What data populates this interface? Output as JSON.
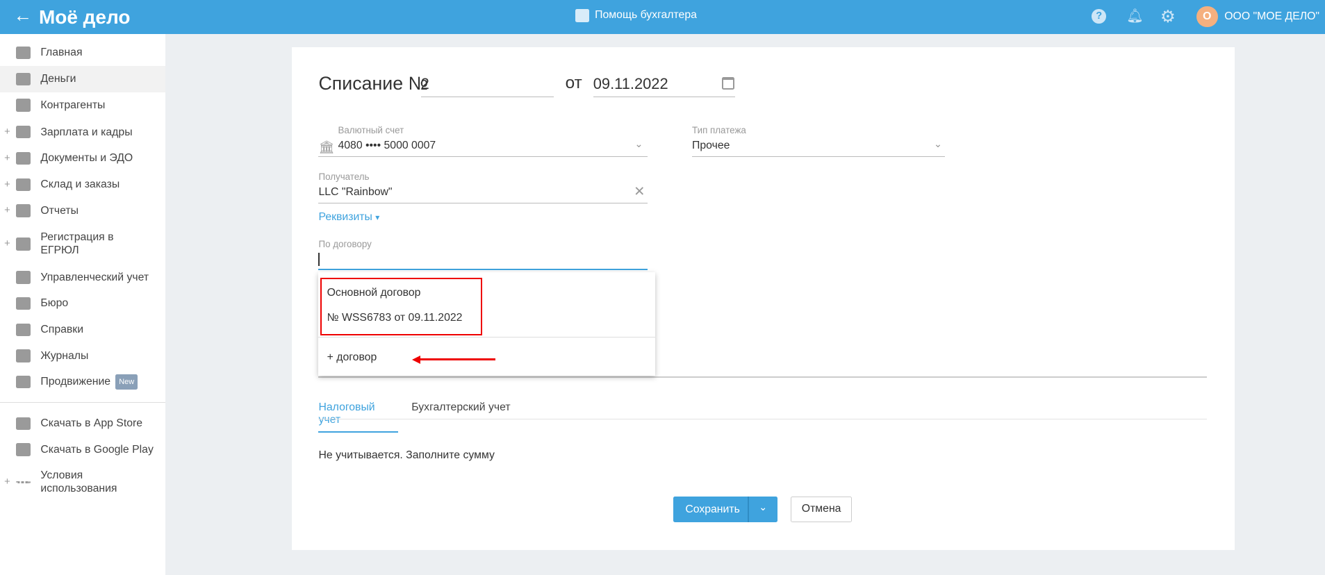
{
  "header": {
    "logo": "Моё дело",
    "help_title": "Помощь бухгалтера",
    "avatar_letter": "О",
    "company": "ООО \"МОЕ ДЕЛО\""
  },
  "sidebar": {
    "items": [
      {
        "label": "Главная",
        "icon": "home-icon",
        "plus": false
      },
      {
        "label": "Деньги",
        "icon": "money-icon",
        "plus": false,
        "active": true
      },
      {
        "label": "Контрагенты",
        "icon": "contractor-icon",
        "plus": false
      },
      {
        "label": "Зарплата и кадры",
        "icon": "wallet-icon",
        "plus": true
      },
      {
        "label": "Документы и ЭДО",
        "icon": "folder-icon",
        "plus": true
      },
      {
        "label": "Склад и заказы",
        "icon": "warehouse-icon",
        "plus": true
      },
      {
        "label": "Отчеты",
        "icon": "report-icon",
        "plus": true
      },
      {
        "label": "Регистрация в ЕГРЮЛ",
        "icon": "registration-icon",
        "plus": true
      },
      {
        "label": "Управленческий учет",
        "icon": "ruble-icon",
        "plus": false
      },
      {
        "label": "Бюро",
        "icon": "briefcase-icon",
        "plus": false
      },
      {
        "label": "Справки",
        "icon": "reference-icon",
        "plus": false
      },
      {
        "label": "Журналы",
        "icon": "journal-icon",
        "plus": false
      },
      {
        "label": "Продвижение",
        "icon": "promotion-icon",
        "plus": false,
        "badge": "New"
      }
    ],
    "bottom": [
      {
        "label": "Скачать в App Store",
        "icon": "apple-icon"
      },
      {
        "label": "Скачать в Google Play",
        "icon": "google-play-icon"
      },
      {
        "label": "Условия использования",
        "icon": "more-icon"
      }
    ]
  },
  "form": {
    "title": "Списание №",
    "number": "2",
    "date_prefix": "от",
    "date": "09.11.2022",
    "account_label": "Валютный счет",
    "account_value": "4080 •••• 5000 0007",
    "payment_type_label": "Тип платежа",
    "payment_type_value": "Прочее",
    "recipient_label": "Получатель",
    "recipient_value": "LLC \"Rainbow\"",
    "details_link": "Реквизиты",
    "contract_label": "По договору",
    "contract_value": "",
    "dropdown": {
      "options": [
        "Основной договор",
        "№ WSS6783 от 09.11.2022"
      ],
      "add": "+ договор"
    },
    "tabs": [
      "Налоговый учет",
      "Бухгалтерский учет"
    ],
    "tax_note": "Не учитывается. Заполните сумму",
    "save": "Сохранить",
    "cancel": "Отмена"
  },
  "colors": {
    "accent": "#3fa3de",
    "highlight": "#ee0000"
  }
}
